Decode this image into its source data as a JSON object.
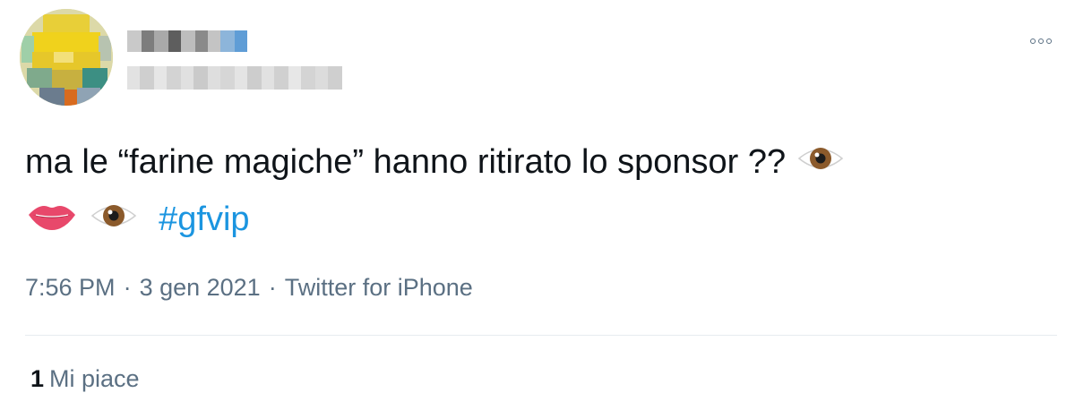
{
  "author": {
    "avatar_icon": "blurred-avatar-icon",
    "name_redacted": true,
    "handle_redacted": true
  },
  "more_icon": "more-options-icon",
  "tweet": {
    "text_main": "ma le “farine magiche” hanno ritirato lo sponsor ??",
    "emoji_1": "eye-icon",
    "emoji_2": "lips-icon",
    "emoji_3": "eye-icon",
    "hashtag": "#gfvip"
  },
  "meta": {
    "time": "7:56 PM",
    "date": "3 gen 2021",
    "separator": "·",
    "source": "Twitter for iPhone"
  },
  "stats": {
    "likes_count": "1",
    "likes_label": "Mi piace"
  },
  "colors": {
    "link": "#1b95e0",
    "secondary_text": "#5b7083",
    "primary_text": "#0f1419",
    "divider": "#e6ecf0"
  }
}
